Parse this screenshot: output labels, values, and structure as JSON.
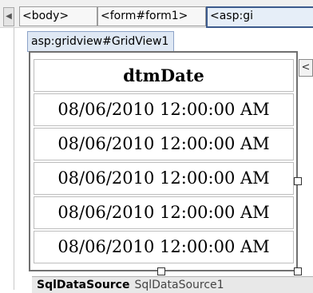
{
  "breadcrumbs": [
    "<body>",
    "<form#form1>",
    "<asp:gi"
  ],
  "gridview": {
    "label": "asp:gridview#GridView1",
    "header": "dtmDate",
    "rows": [
      "08/06/2010 12:00:00 AM",
      "08/06/2010 12:00:00 AM",
      "08/06/2010 12:00:00 AM",
      "08/06/2010 12:00:00 AM",
      "08/06/2010 12:00:00 AM"
    ],
    "smart_tag_glyph": "<"
  },
  "datasource": {
    "type": "SqlDataSource",
    "name": "SqlDataSource1"
  },
  "icons": {
    "nav": "chevron-left-icon"
  }
}
